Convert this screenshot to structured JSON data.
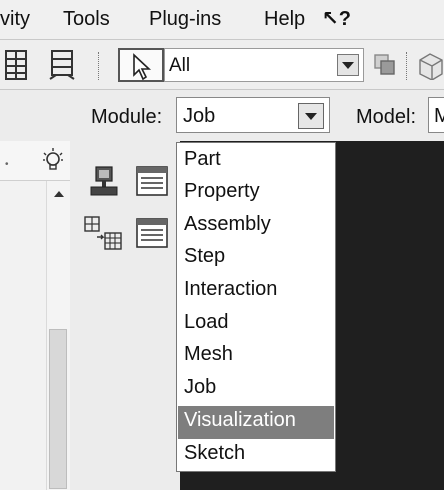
{
  "menubar": {
    "partial_item": "vity",
    "items": [
      "Tools",
      "Plug-ins",
      "Help"
    ],
    "context_help_label": "↖?"
  },
  "toolbar": {
    "selection_filter_value": "All"
  },
  "module_row": {
    "module_label": "Module:",
    "module_value": "Job",
    "model_label": "Model:",
    "model_value": "M"
  },
  "module_dropdown": {
    "options": [
      "Part",
      "Property",
      "Assembly",
      "Step",
      "Interaction",
      "Load",
      "Mesh",
      "Job",
      "Visualization",
      "Sketch"
    ],
    "highlighted": "Visualization"
  },
  "colors": {
    "viewport_bg": "#1f1f1f",
    "highlight": "#7e7e7e"
  }
}
